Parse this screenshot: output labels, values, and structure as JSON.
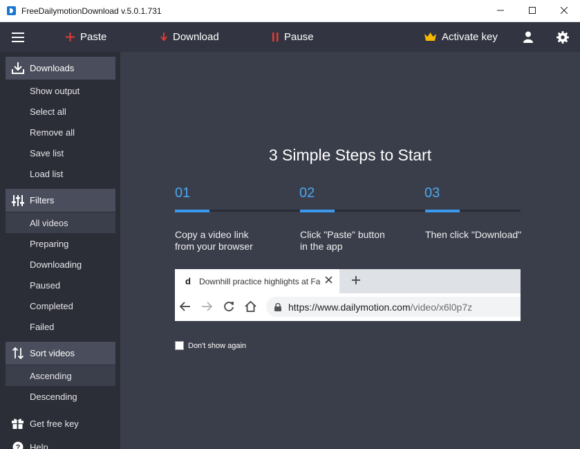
{
  "window": {
    "title": "FreeDailymotionDownload  v.5.0.1.731"
  },
  "toolbar": {
    "paste_label": "Paste",
    "download_label": "Download",
    "pause_label": "Pause",
    "activate_label": "Activate key"
  },
  "sidebar": {
    "downloads": {
      "header": "Downloads",
      "items": [
        "Show output",
        "Select all",
        "Remove all",
        "Save list",
        "Load list"
      ]
    },
    "filters": {
      "header": "Filters",
      "items": [
        "All videos",
        "Preparing",
        "Downloading",
        "Paused",
        "Completed",
        "Failed"
      ],
      "selected": "All videos"
    },
    "sort": {
      "header": "Sort videos",
      "items": [
        "Ascending",
        "Descending"
      ],
      "selected": "Ascending"
    },
    "get_free_key": "Get free key",
    "help": "Help"
  },
  "main": {
    "title": "3 Simple Steps to Start",
    "steps": [
      {
        "number": "01",
        "line1": "Copy a video link",
        "line2": "from your browser"
      },
      {
        "number": "02",
        "line1": "Click \"Paste\" button",
        "line2": "in the app"
      },
      {
        "number": "03",
        "line1": "Then click \"Download\"",
        "line2": ""
      }
    ],
    "browser": {
      "favicon": "d",
      "tab_title": "Downhill practice highlights at Fa",
      "url_host": "https://www.dailymotion.com",
      "url_path": "/video/x6l0p7z"
    },
    "dont_show_label": "Don't show again"
  },
  "colors": {
    "accent_blue": "#3b99ee",
    "step_number": "#4aa8f0",
    "toolbar_red": "#e53935",
    "crown_gold": "#f5b800",
    "sidebar_bg": "#2b2d37",
    "main_bg": "#3a3e4a"
  }
}
